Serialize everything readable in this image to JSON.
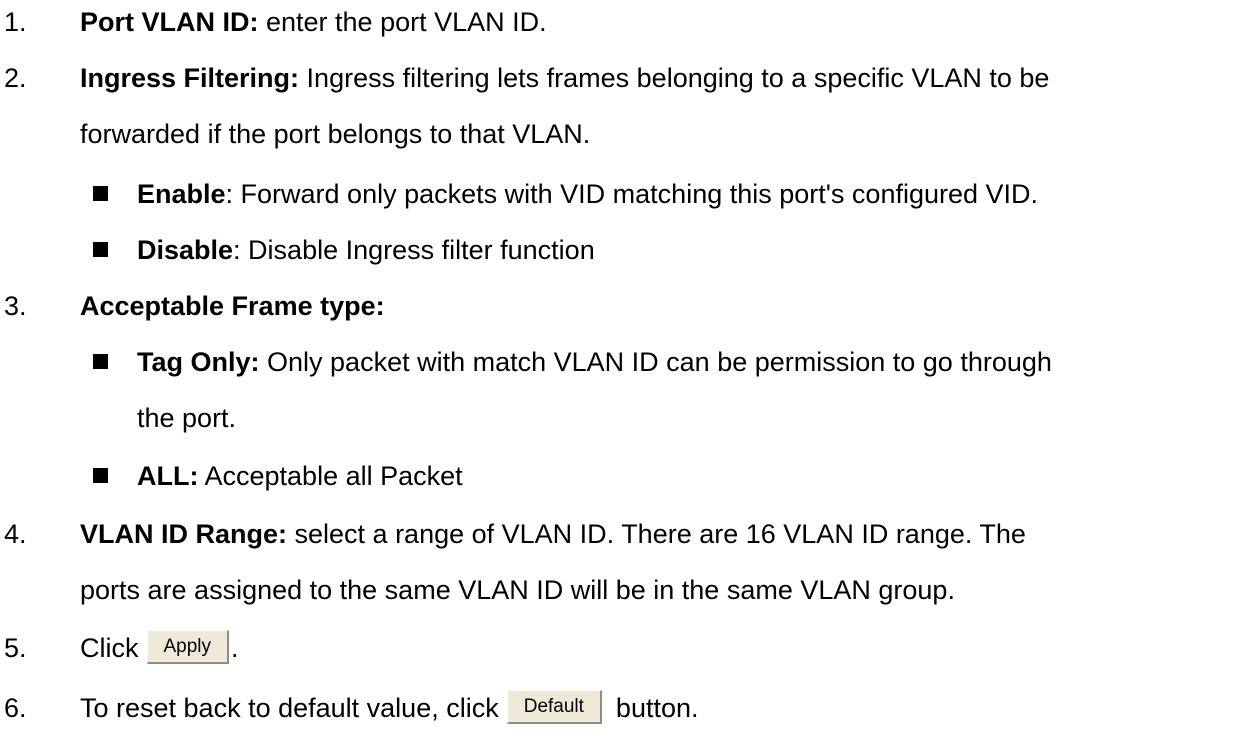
{
  "items": [
    {
      "num": "1.",
      "term": "Port VLAN ID:",
      "desc": " enter the port VLAN ID."
    },
    {
      "num": "2.",
      "term": "Ingress Filtering:",
      "desc": " Ingress filtering lets frames belonging to a specific VLAN to be",
      "cont": "forwarded if the port belongs to that VLAN."
    },
    {
      "num": "3.",
      "term": "Acceptable Frame type:",
      "desc": ""
    },
    {
      "num": "4.",
      "term": "VLAN ID Range:",
      "desc": " select a range of VLAN ID. There are 16 VLAN ID range. The",
      "cont": "ports are assigned to the same VLAN ID will be in the same VLAN group."
    },
    {
      "num": "5.",
      "pre": "Click",
      "button": "Apply",
      "post": "."
    },
    {
      "num": "6.",
      "pre": "To reset back to default value, click",
      "button": "Default",
      "post": "button."
    }
  ],
  "ingress_options": [
    {
      "term": "Enable",
      "desc": ": Forward only packets with VID matching this port's configured VID."
    },
    {
      "term": "Disable",
      "desc": ": Disable Ingress filter function"
    }
  ],
  "frame_options": [
    {
      "term": "Tag Only:",
      "desc": " Only packet with match VLAN ID can be permission to go through",
      "cont": "the port."
    },
    {
      "term": "ALL:",
      "desc": " Acceptable all Packet"
    }
  ]
}
